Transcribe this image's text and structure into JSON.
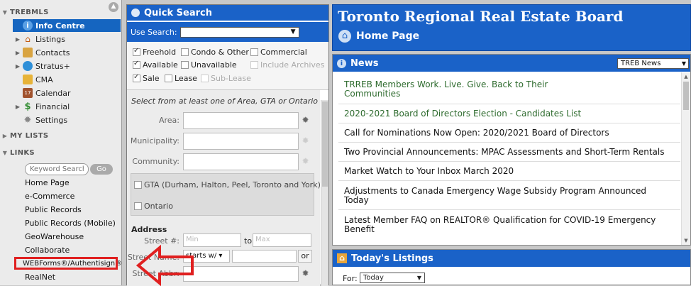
{
  "sidebar": {
    "trebmls_label": "TREBMLS",
    "items": [
      {
        "label": "Info Centre",
        "icon": "info-icon",
        "active": true
      },
      {
        "label": "Listings",
        "icon": "house-icon"
      },
      {
        "label": "Contacts",
        "icon": "address-book-icon"
      },
      {
        "label": "Stratus+",
        "icon": "map-pin-icon"
      },
      {
        "label": "CMA",
        "icon": "cma-icon"
      },
      {
        "label": "Calendar",
        "icon": "calendar-icon"
      },
      {
        "label": "Financial",
        "icon": "dollar-icon"
      },
      {
        "label": "Settings",
        "icon": "gear-icon"
      }
    ],
    "my_lists_label": "MY LISTS",
    "links_label": "LINKS",
    "keyword_placeholder": "Keyword Search",
    "go_label": "Go",
    "links": [
      "Home Page",
      "e-Commerce",
      "Public Records",
      "Public Records (Mobile)",
      "GeoWarehouse",
      "Collaborate",
      "WEBForms®/Authentisign®",
      "RealNet"
    ]
  },
  "quick_search": {
    "title": "Quick Search",
    "use_search_label": "Use Search:",
    "use_search_value": "",
    "types": {
      "freehold": "Freehold",
      "condo": "Condo & Other",
      "commercial": "Commercial"
    },
    "status": {
      "available": "Available",
      "unavailable": "Unavailable",
      "archives": "Include Archives"
    },
    "sale": "Sale",
    "lease": "Lease",
    "sublease": "Sub-Lease",
    "instruction": "Select from at least one of Area, GTA or Ontario",
    "area_label": "Area:",
    "municipality_label": "Municipality:",
    "community_label": "Community:",
    "gta_label": "GTA (Durham, Halton, Peel, Toronto and York)",
    "ontario_label": "Ontario",
    "address_label": "Address",
    "street_num_label": "Street #:",
    "min_placeholder": "Min",
    "to_label": "to",
    "max_placeholder": "Max",
    "street_name_label": "Street Name:",
    "starts_with": "starts w/",
    "or_label": "or",
    "street_abbr_label": "Street Abbr:"
  },
  "board": {
    "title": "Toronto Regional Real Estate Board",
    "home_label": "Home Page"
  },
  "news": {
    "title": "News",
    "filter": "TREB News",
    "items": [
      {
        "text": "TRREB Members Work. Live. Give. Back to Their",
        "text2": "Communities",
        "color": "#2e6b2e"
      },
      {
        "text": "2020-2021 Board of Directors Election - Candidates List",
        "color": "#2e6b2e"
      },
      {
        "text": "Call for Nominations Now Open: 2020/2021 Board of Directors",
        "color": "#111111"
      },
      {
        "text": "Two Provincial Announcements: MPAC Assessments and Short-Term Rentals",
        "color": "#111111"
      },
      {
        "text": "Market Watch to Your Inbox March 2020",
        "color": "#111111"
      },
      {
        "text": "Adjustments to Canada Emergency Wage Subsidy Program Announced",
        "text2": "Today",
        "color": "#111111"
      },
      {
        "text": "Latest Member FAQ on REALTOR® Qualification for COVID-19 Emergency",
        "text2": "Benefit",
        "color": "#111111"
      }
    ]
  },
  "todays_listings": {
    "title": "Today's Listings",
    "for_label": "For:",
    "for_value": "Today"
  }
}
